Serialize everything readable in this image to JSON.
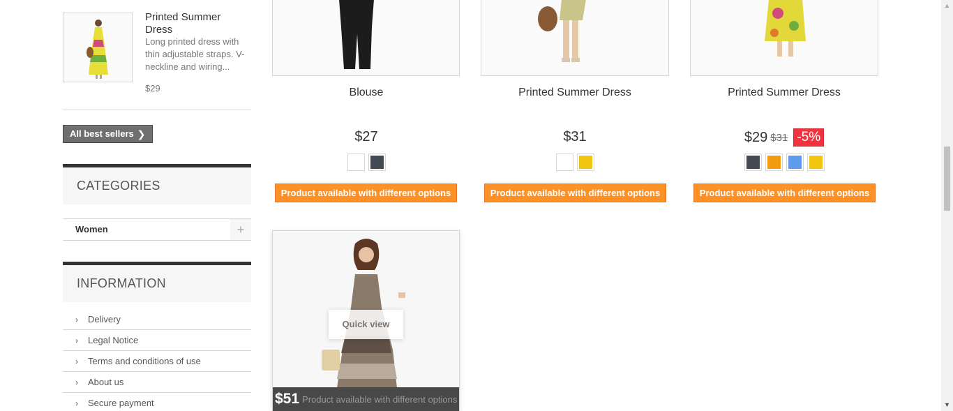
{
  "sidebar": {
    "bestseller": {
      "name": "Printed Summer Dress",
      "description": "Long printed dress with thin adjustable straps. V-neckline and wiring...",
      "price": "$29"
    },
    "all_best_sellers_label": "All best sellers",
    "categories": {
      "title": "CATEGORIES",
      "items": [
        {
          "label": "Women"
        }
      ]
    },
    "information": {
      "title": "INFORMATION",
      "items": [
        {
          "label": "Delivery"
        },
        {
          "label": "Legal Notice"
        },
        {
          "label": "Terms and conditions of use"
        },
        {
          "label": "About us"
        },
        {
          "label": "Secure payment"
        }
      ]
    }
  },
  "products": [
    {
      "name": "Blouse",
      "price": "$27",
      "availability": "Product available with different options",
      "swatches": [
        "#ffffff",
        "#434a54"
      ]
    },
    {
      "name": "Printed Summer Dress",
      "price": "$31",
      "availability": "Product available with different options",
      "swatches": [
        "#ffffff",
        "#f1c40f"
      ]
    },
    {
      "name": "Printed Summer Dress",
      "price": "$29",
      "old_price": "$31",
      "discount": "-5%",
      "availability": "Product available with different options",
      "swatches": [
        "#434a54",
        "#f39c11",
        "#5d9cec",
        "#f1c40f"
      ]
    },
    {
      "price": "$51",
      "availability": "Product available with different options",
      "quick_view_label": "Quick view"
    }
  ],
  "colors": {
    "availability_bg": "#fe9126",
    "discount_bg": "#f13340",
    "hover_bar_bg": "#484848"
  }
}
